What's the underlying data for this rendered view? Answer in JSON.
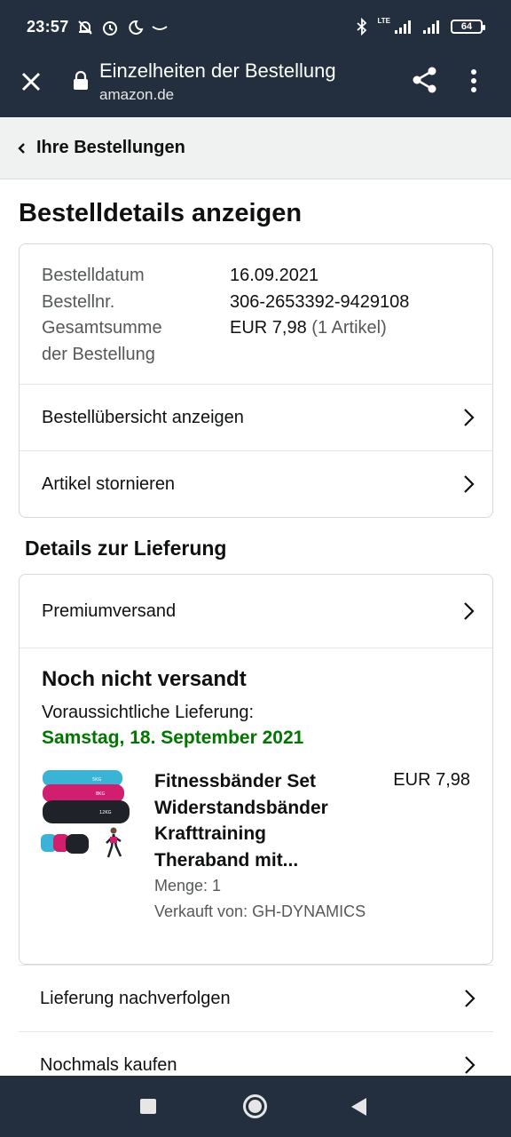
{
  "status_bar": {
    "time": "23:57",
    "network": "LTE",
    "battery": "64",
    "icons": [
      "muted-bell-icon",
      "alarm-icon",
      "do-not-disturb-icon",
      "wave-icon",
      "bluetooth-icon",
      "signal-icon",
      "signal-icon",
      "battery-icon"
    ]
  },
  "browser": {
    "title": "Einzelheiten der Bestellung",
    "url": "amazon.de"
  },
  "breadcrumb": {
    "label": "Ihre Bestellungen"
  },
  "page": {
    "title": "Bestelldetails anzeigen"
  },
  "order_info": {
    "date_label": "Bestelldatum",
    "date_value": "16.09.2021",
    "number_label": "Bestellnr.",
    "number_value": "306-2653392-9429108",
    "total_label_1": "Gesamtsumme",
    "total_label_2": "der Bestellung",
    "total_value": "EUR 7,98",
    "total_items": "(1 Artikel)"
  },
  "order_links": {
    "overview": "Bestellübersicht anzeigen",
    "cancel": "Artikel stornieren"
  },
  "delivery": {
    "section_title": "Details zur Lieferung",
    "shipping_method": "Premiumversand",
    "status": "Noch nicht versandt",
    "eta_label": "Voraussichtliche Lieferung:",
    "eta_date": "Samstag, 18. September 2021",
    "eta_color": "#007600"
  },
  "product": {
    "name": "Fitnessbänder Set Widerstandsbänder Krafttraining Theraband mit...",
    "price": "EUR 7,98",
    "quantity": "Menge: 1",
    "seller": "Verkauft von: GH-DYNAMICS",
    "band_labels": [
      "5KG",
      "8KG",
      "12KG"
    ]
  },
  "bottom_links": {
    "track": "Lieferung nachverfolgen",
    "buy_again": "Nochmals kaufen"
  },
  "colors": {
    "header_bg": "#232f3e",
    "breadcrumb_bg": "#f0f2f2"
  }
}
